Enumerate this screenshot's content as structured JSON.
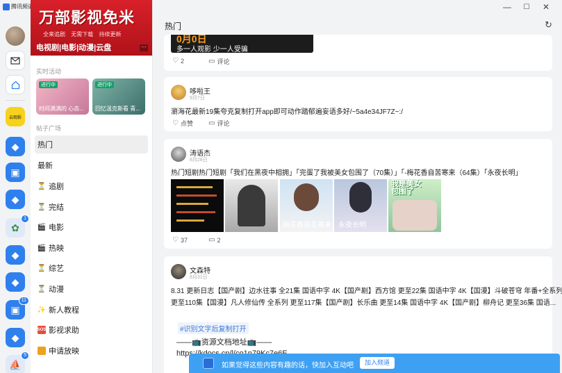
{
  "window": {
    "app_name": "腾讯频道",
    "controls": [
      "—",
      "☐",
      "✕"
    ]
  },
  "rail": {
    "badges": [
      "1",
      "11",
      "5"
    ],
    "yellow_channel_text": "云观影"
  },
  "sidebar": {
    "banner": {
      "title": "万部影视免米",
      "subtitle": "全来追剧 无需下载 持续更新",
      "tags": "电视剧|电影|动漫|云盘"
    },
    "activity_label": "实时活动",
    "activities": [
      {
        "tag": "进行中",
        "caption": "时间满满的 心态..."
      },
      {
        "tag": "进行中",
        "caption": "回忆温克斯看 青..."
      }
    ],
    "posts_label": "帖子广场",
    "nav": [
      {
        "label": "热门",
        "icon": "",
        "active": true
      },
      {
        "label": "最新",
        "icon": ""
      },
      {
        "label": "追剧",
        "icon": "hourglass-icon"
      },
      {
        "label": "完结",
        "icon": "hourglass-icon"
      },
      {
        "label": "电影",
        "icon": "clapper-icon"
      },
      {
        "label": "热映",
        "icon": "clapper-icon"
      },
      {
        "label": "综艺",
        "icon": "hourglass-icon"
      },
      {
        "label": "动漫",
        "icon": "hourglass-icon"
      },
      {
        "label": "新人教程",
        "icon": "sparkle-icon"
      },
      {
        "label": "影视求助",
        "icon": "sos-icon"
      },
      {
        "label": "申请放映",
        "icon": "apply-icon"
      }
    ],
    "sos_text": "SOS"
  },
  "main": {
    "title": "热门",
    "posts": [
      {
        "image_text_1": "0月0日",
        "image_text_2": "多一人观影 少一人受骗",
        "likes": "2",
        "comment_label": "评论"
      },
      {
        "author": "哆啦王",
        "date": "9月7日",
        "text": "瀏海花最新19集夸克复制打开app即可动作踏郁遍妄语多好/~5a4e34JF7Z~:/",
        "like_label": "点赞",
        "comment_label": "评论"
      },
      {
        "author": "涛语杰",
        "date": "8月28日",
        "text": "热门短剧热门短剧「我们在黑夜中相拥」「完蛋了我被美女包围了（70集）」「-梅花香自苦寒来（64集）「永夜长明」",
        "image_captions": [
          "",
          "",
          "梅花香自苦寒来",
          "永夜长明",
          "我是美女\n包围了"
        ],
        "likes": "37",
        "comments": "2"
      },
      {
        "author": "文森特",
        "date": "8月31日",
        "line1": "8.31 更新日志【国产剧】边水往事 全21集 国语中字 4K【国产剧】西方馆 更至22集 国语中字 4K【国漫】斗破苍穹 年番+全系列",
        "line2": "更至110集【国漫】凡人修仙传 全系列 更至117集【国产剧】长乐曲 更至14集 国语中字 4K【国产剧】柳舟记 更至36集 国语...",
        "hashtag": "#识别文字后复制打开",
        "link_title": "——📺资源文档地址📺——",
        "link_url": "https://kdocs.cn/l/co1n79Kc7e6E"
      }
    ]
  },
  "joinbar": {
    "message": "如果觉得这些内容有趣的话，快加入互动吧",
    "button": "加入频道"
  },
  "colors": {
    "accent": "#2f80ed",
    "banner_red": "#d8202a",
    "joinbar_blue": "#3ea0f2"
  }
}
